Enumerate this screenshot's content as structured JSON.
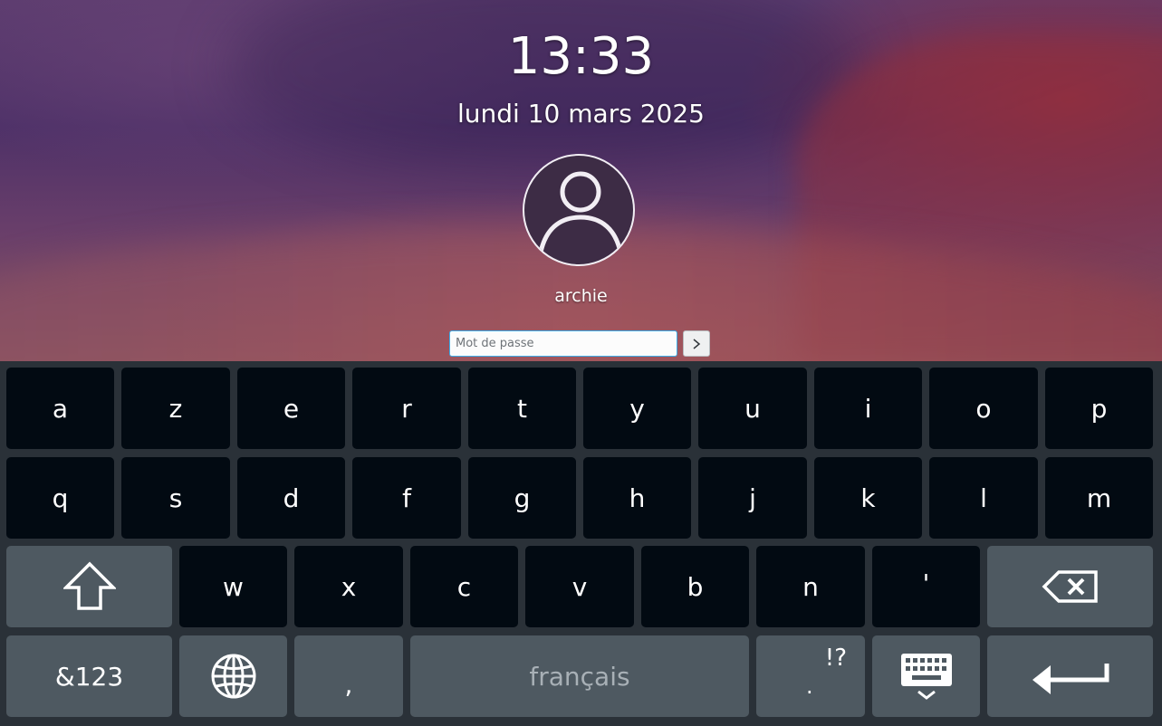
{
  "lockscreen": {
    "time": "13:33",
    "date": "lundi 10 mars 2025",
    "username": "archie",
    "password_placeholder": "Mot de passe"
  },
  "keyboard": {
    "row1": [
      "a",
      "z",
      "e",
      "r",
      "t",
      "y",
      "u",
      "i",
      "o",
      "p"
    ],
    "row2": [
      "q",
      "s",
      "d",
      "f",
      "g",
      "h",
      "j",
      "k",
      "l",
      "m"
    ],
    "row3": [
      "w",
      "x",
      "c",
      "v",
      "b",
      "n",
      "'"
    ],
    "symbols_label": "&123",
    "comma": ",",
    "space_label": "français",
    "period": ".",
    "period_alt": "!?"
  },
  "icons": {
    "avatar": "user-avatar-icon",
    "submit": "chevron-right-icon",
    "shift": "shift-arrow-icon",
    "backspace": "backspace-icon",
    "language": "globe-icon",
    "hide_keyboard": "keyboard-hide-icon",
    "enter": "enter-arrow-icon"
  },
  "colors": {
    "key_dark": "#020a12",
    "key_function": "#4e5961",
    "keyboard_background": "#2a3138",
    "input_focus_border": "#3daee9"
  }
}
